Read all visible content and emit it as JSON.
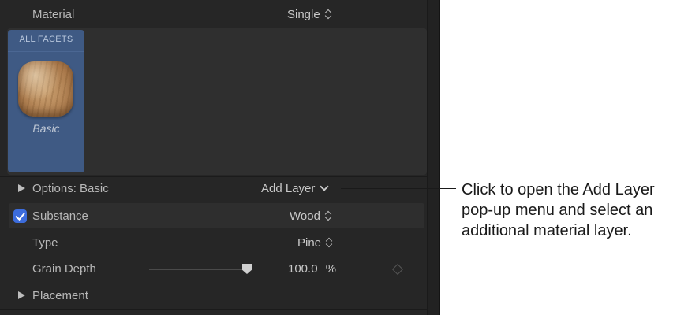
{
  "inspector": {
    "material_row": {
      "label": "Material",
      "value": "Single"
    },
    "facet": {
      "header": "ALL FACETS",
      "name": "Basic",
      "swatch_icon": "wood-texture-swatch-icon"
    },
    "options_row": {
      "label": "Options: Basic",
      "add_layer_label": "Add Layer"
    },
    "substance_row": {
      "label": "Substance",
      "value": "Wood",
      "checked": true
    },
    "type_row": {
      "label": "Type",
      "value": "Pine"
    },
    "grain_depth_row": {
      "label": "Grain Depth",
      "value": "100.0",
      "unit": "%",
      "slider_level": 1.0
    },
    "placement_row": {
      "label": "Placement"
    }
  },
  "callout": {
    "text": "Click to open the Add Layer pop-up menu and select an additional material layer."
  },
  "colors": {
    "panel_bg": "#262626",
    "facet_tile": "#3f5a84",
    "checkbox_accent": "#3c6cdc",
    "callout_text": "#1a1a1a"
  }
}
